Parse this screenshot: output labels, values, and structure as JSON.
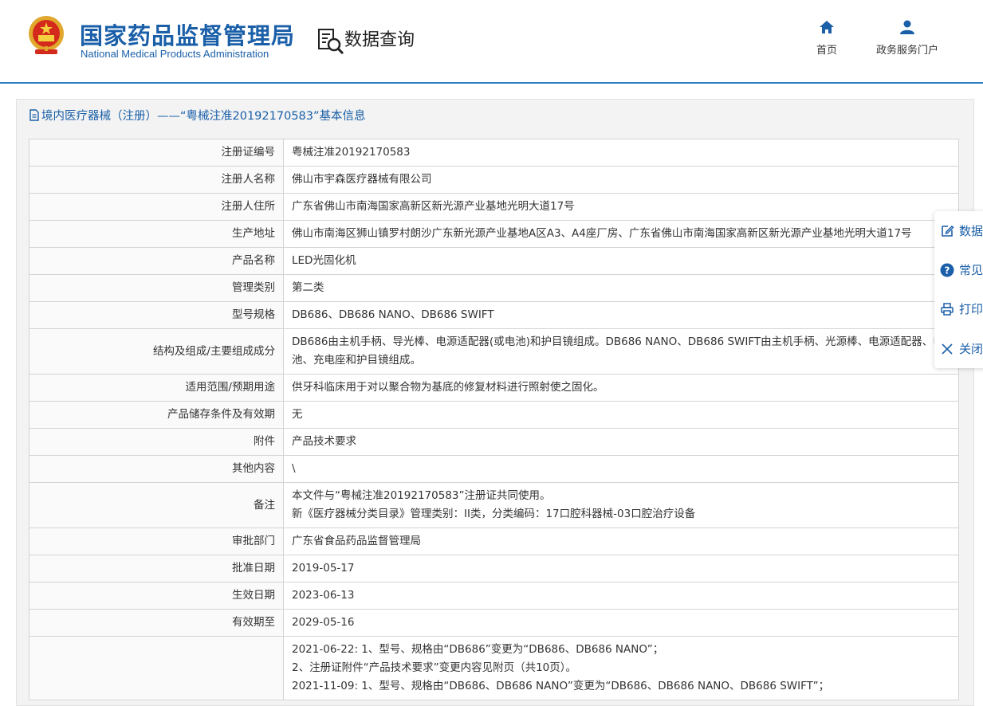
{
  "header": {
    "site_title_cn": "国家药品监督管理局",
    "site_title_en": "National Medical Products Administration",
    "data_query_label": "数据查询",
    "nav": [
      {
        "label": "首页",
        "icon": "home-icon"
      },
      {
        "label": "政务服务门户",
        "icon": "user-icon"
      }
    ]
  },
  "panel": {
    "title": "境内医疗器械（注册）——“粤械注准20192170583”基本信息"
  },
  "rows": [
    {
      "label": "注册证编号",
      "value": "粤械注准20192170583"
    },
    {
      "label": "注册人名称",
      "value": "佛山市宇森医疗器械有限公司"
    },
    {
      "label": "注册人住所",
      "value": "广东省佛山市南海国家高新区新光源产业基地光明大道17号"
    },
    {
      "label": "生产地址",
      "value": "佛山市南海区狮山镇罗村朗沙广东新光源产业基地A区A3、A4座厂房、广东省佛山市南海国家高新区新光源产业基地光明大道17号"
    },
    {
      "label": "产品名称",
      "value": "LED光固化机"
    },
    {
      "label": "管理类别",
      "value": "第二类"
    },
    {
      "label": "型号规格",
      "value": "DB686、DB686 NANO、DB686 SWIFT"
    },
    {
      "label": "结构及组成/主要组成成分",
      "value": "DB686由主机手柄、导光棒、电源适配器(或电池)和护目镜组成。DB686 NANO、DB686 SWIFT由主机手柄、光源棒、电源适配器、电池、充电座和护目镜组成。"
    },
    {
      "label": "适用范围/预期用途",
      "value": "供牙科临床用于对以聚合物为基底的修复材料进行照射使之固化。"
    },
    {
      "label": "产品储存条件及有效期",
      "value": "无"
    },
    {
      "label": "附件",
      "value": "产品技术要求"
    },
    {
      "label": "其他内容",
      "value": "\\"
    },
    {
      "label": "备注",
      "lines": [
        "本文件与“粤械注准20192170583”注册证共同使用。",
        "新《医疗器械分类目录》管理类别：II类，分类编码：17口腔科器械-03口腔治疗设备"
      ]
    },
    {
      "label": "审批部门",
      "value": "广东省食品药品监督管理局"
    },
    {
      "label": "批准日期",
      "value": "2019-05-17"
    },
    {
      "label": "生效日期",
      "value": "2023-06-13"
    },
    {
      "label": "有效期至",
      "value": "2029-05-16"
    },
    {
      "label": "",
      "lines": [
        "2021-06-22: 1、型号、规格由“DB686”变更为“DB686、DB686 NANO”；",
        "2、注册证附件“产品技术要求”变更内容见附页（共10页）。",
        "2021-11-09: 1、型号、规格由“DB686、DB686 NANO”变更为“DB686、DB686 NANO、DB686 SWIFT”；"
      ]
    }
  ],
  "float_menu": [
    {
      "label": "数据",
      "icon": "edit-icon"
    },
    {
      "label": "常见",
      "icon": "help-icon"
    },
    {
      "label": "打印",
      "icon": "print-icon"
    },
    {
      "label": "关闭",
      "icon": "close-icon"
    }
  ]
}
